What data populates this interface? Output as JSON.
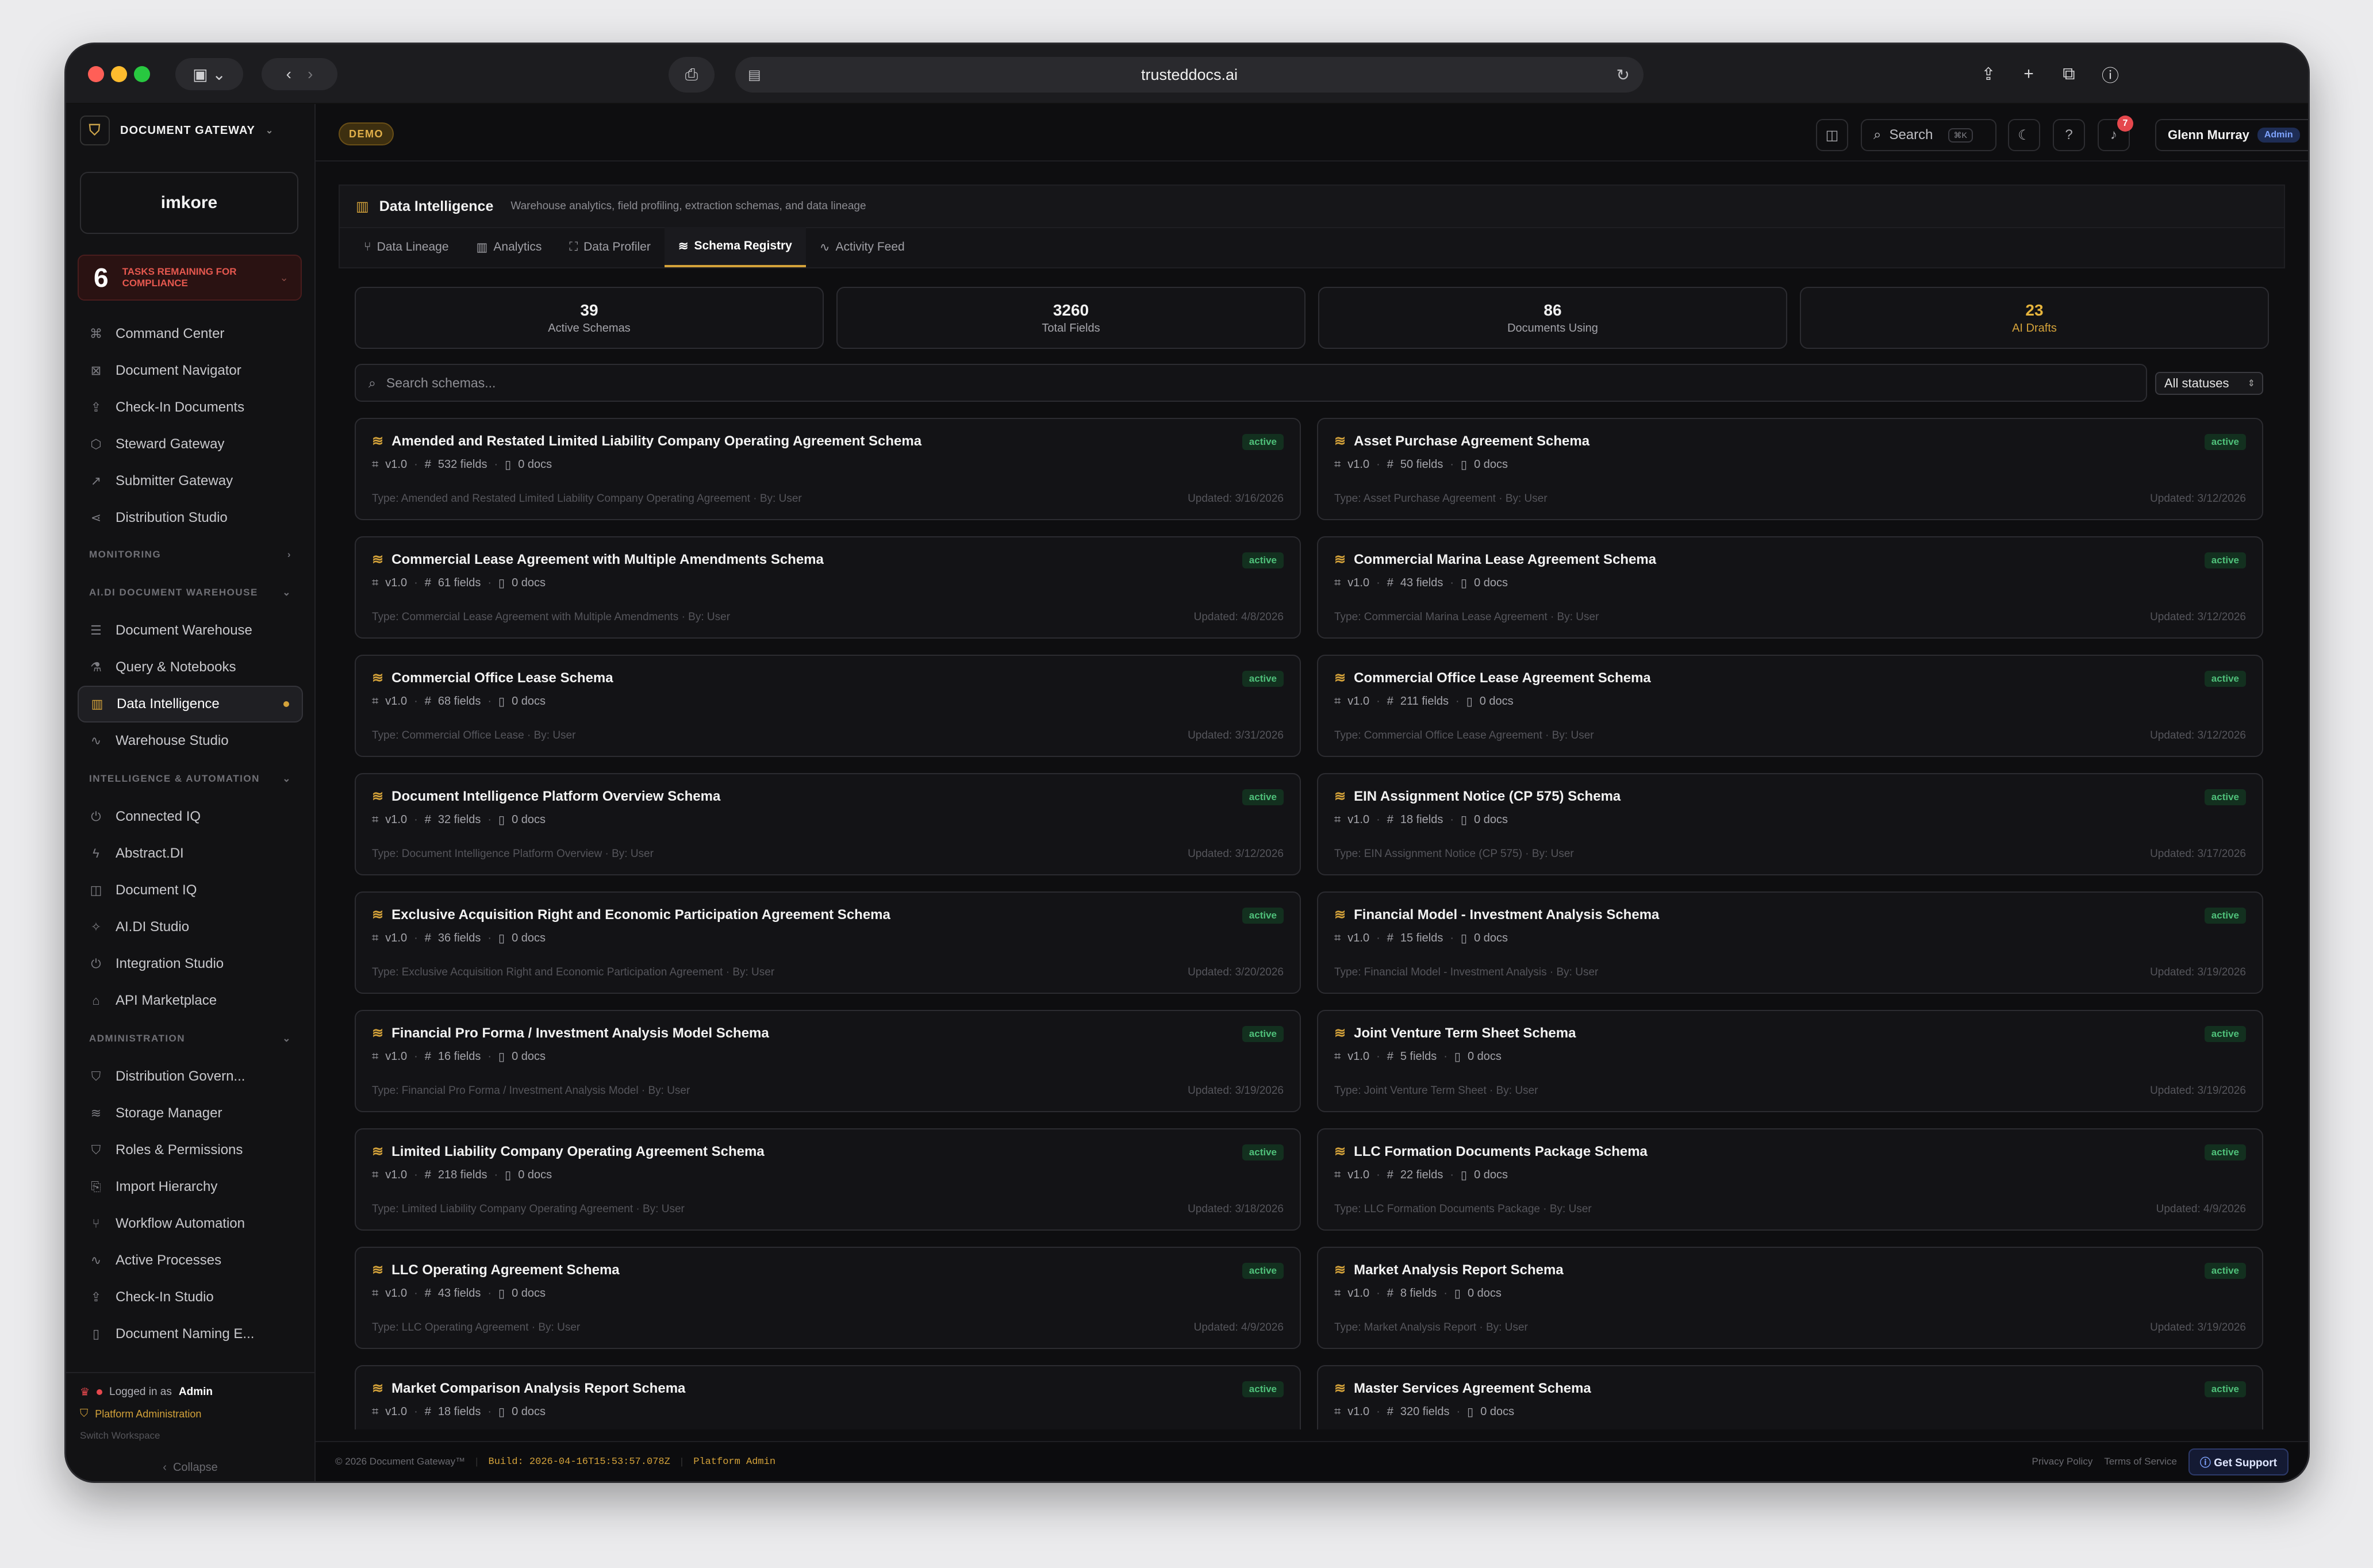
{
  "browser": {
    "url": "trusteddocs.ai"
  },
  "sidebar": {
    "brand": "DOCUMENT GATEWAY",
    "org_logo": "imkore",
    "tasks": {
      "count": "6",
      "label": "TASKS REMAINING FOR COMPLIANCE"
    },
    "top_items": [
      {
        "label": "Command Center",
        "icon": "command-icon"
      },
      {
        "label": "Document Navigator",
        "icon": "navigator-icon"
      },
      {
        "label": "Check-In Documents",
        "icon": "upload-icon"
      },
      {
        "label": "Steward Gateway",
        "icon": "box-icon"
      },
      {
        "label": "Submitter Gateway",
        "icon": "external-link-icon"
      },
      {
        "label": "Distribution Studio",
        "icon": "share-icon"
      }
    ],
    "sections": {
      "monitoring": "MONITORING",
      "warehouse": "AI.DI DOCUMENT WAREHOUSE",
      "intel": "INTELLIGENCE & AUTOMATION",
      "admin": "ADMINISTRATION"
    },
    "warehouse_items": [
      {
        "label": "Document Warehouse"
      },
      {
        "label": "Query & Notebooks"
      },
      {
        "label": "Data Intelligence",
        "active": true
      },
      {
        "label": "Warehouse Studio"
      }
    ],
    "intel_items": [
      {
        "label": "Connected IQ"
      },
      {
        "label": "Abstract.DI"
      },
      {
        "label": "Document IQ"
      },
      {
        "label": "AI.DI Studio"
      },
      {
        "label": "Integration Studio"
      },
      {
        "label": "API Marketplace"
      }
    ],
    "admin_items": [
      {
        "label": "Distribution Govern..."
      },
      {
        "label": "Storage Manager"
      },
      {
        "label": "Roles & Permissions"
      },
      {
        "label": "Import Hierarchy"
      },
      {
        "label": "Workflow Automation"
      },
      {
        "label": "Active Processes"
      },
      {
        "label": "Check-In Studio"
      },
      {
        "label": "Document Naming E..."
      }
    ],
    "footer": {
      "logged_in_prefix": "Logged in as",
      "logged_in_role": "Admin",
      "platform": "Platform Administration",
      "switch": "Switch Workspace",
      "collapse": "Collapse"
    }
  },
  "topbar": {
    "demo": "DEMO",
    "search_label": "Search",
    "search_kbd": "⌘K",
    "notifications": "7",
    "user_name": "Glenn Murray",
    "user_role": "Admin"
  },
  "page": {
    "title": "Data Intelligence",
    "subtitle": "Warehouse analytics, field profiling, extraction schemas, and data lineage",
    "tabs": [
      {
        "label": "Data Lineage",
        "icon": "lineage-icon"
      },
      {
        "label": "Analytics",
        "icon": "bar-chart-icon"
      },
      {
        "label": "Data Profiler",
        "icon": "scan-icon"
      },
      {
        "label": "Schema Registry",
        "icon": "layers-icon",
        "active": true
      },
      {
        "label": "Activity Feed",
        "icon": "activity-icon"
      }
    ]
  },
  "stats": [
    {
      "value": "39",
      "label": "Active Schemas"
    },
    {
      "value": "3260",
      "label": "Total Fields"
    },
    {
      "value": "86",
      "label": "Documents Using"
    },
    {
      "value": "23",
      "label": "AI Drafts",
      "accent": "#e6b43c"
    }
  ],
  "filter": {
    "placeholder": "Search schemas...",
    "status": "All statuses"
  },
  "schemas": [
    {
      "name": "Amended and Restated Limited Liability Company Operating Agreement Schema",
      "status": "active",
      "version": "v1.0",
      "fields": "532 fields",
      "docs": "0 docs",
      "type": "Type: Amended and Restated Limited Liability Company Operating Agreement · By: User",
      "updated": "Updated: 3/16/2026"
    },
    {
      "name": "Asset Purchase Agreement Schema",
      "status": "active",
      "version": "v1.0",
      "fields": "50 fields",
      "docs": "0 docs",
      "type": "Type: Asset Purchase Agreement · By: User",
      "updated": "Updated: 3/12/2026"
    },
    {
      "name": "Commercial Lease Agreement with Multiple Amendments Schema",
      "status": "active",
      "version": "v1.0",
      "fields": "61 fields",
      "docs": "0 docs",
      "type": "Type: Commercial Lease Agreement with Multiple Amendments · By: User",
      "updated": "Updated: 4/8/2026"
    },
    {
      "name": "Commercial Marina Lease Agreement Schema",
      "status": "active",
      "version": "v1.0",
      "fields": "43 fields",
      "docs": "0 docs",
      "type": "Type: Commercial Marina Lease Agreement · By: User",
      "updated": "Updated: 3/12/2026"
    },
    {
      "name": "Commercial Office Lease Schema",
      "status": "active",
      "version": "v1.0",
      "fields": "68 fields",
      "docs": "0 docs",
      "type": "Type: Commercial Office Lease · By: User",
      "updated": "Updated: 3/31/2026"
    },
    {
      "name": "Commercial Office Lease Agreement Schema",
      "status": "active",
      "version": "v1.0",
      "fields": "211 fields",
      "docs": "0 docs",
      "type": "Type: Commercial Office Lease Agreement · By: User",
      "updated": "Updated: 3/12/2026"
    },
    {
      "name": "Document Intelligence Platform Overview Schema",
      "status": "active",
      "version": "v1.0",
      "fields": "32 fields",
      "docs": "0 docs",
      "type": "Type: Document Intelligence Platform Overview · By: User",
      "updated": "Updated: 3/12/2026"
    },
    {
      "name": "EIN Assignment Notice (CP 575) Schema",
      "status": "active",
      "version": "v1.0",
      "fields": "18 fields",
      "docs": "0 docs",
      "type": "Type: EIN Assignment Notice (CP 575) · By: User",
      "updated": "Updated: 3/17/2026"
    },
    {
      "name": "Exclusive Acquisition Right and Economic Participation Agreement Schema",
      "status": "active",
      "version": "v1.0",
      "fields": "36 fields",
      "docs": "0 docs",
      "type": "Type: Exclusive Acquisition Right and Economic Participation Agreement · By: User",
      "updated": "Updated: 3/20/2026"
    },
    {
      "name": "Financial Model - Investment Analysis Schema",
      "status": "active",
      "version": "v1.0",
      "fields": "15 fields",
      "docs": "0 docs",
      "type": "Type: Financial Model - Investment Analysis · By: User",
      "updated": "Updated: 3/19/2026"
    },
    {
      "name": "Financial Pro Forma / Investment Analysis Model Schema",
      "status": "active",
      "version": "v1.0",
      "fields": "16 fields",
      "docs": "0 docs",
      "type": "Type: Financial Pro Forma / Investment Analysis Model · By: User",
      "updated": "Updated: 3/19/2026"
    },
    {
      "name": "Joint Venture Term Sheet Schema",
      "status": "active",
      "version": "v1.0",
      "fields": "5 fields",
      "docs": "0 docs",
      "type": "Type: Joint Venture Term Sheet · By: User",
      "updated": "Updated: 3/19/2026"
    },
    {
      "name": "Limited Liability Company Operating Agreement Schema",
      "status": "active",
      "version": "v1.0",
      "fields": "218 fields",
      "docs": "0 docs",
      "type": "Type: Limited Liability Company Operating Agreement · By: User",
      "updated": "Updated: 3/18/2026"
    },
    {
      "name": "LLC Formation Documents Package Schema",
      "status": "active",
      "version": "v1.0",
      "fields": "22 fields",
      "docs": "0 docs",
      "type": "Type: LLC Formation Documents Package · By: User",
      "updated": "Updated: 4/9/2026"
    },
    {
      "name": "LLC Operating Agreement Schema",
      "status": "active",
      "version": "v1.0",
      "fields": "43 fields",
      "docs": "0 docs",
      "type": "Type: LLC Operating Agreement · By: User",
      "updated": "Updated: 4/9/2026"
    },
    {
      "name": "Market Analysis Report Schema",
      "status": "active",
      "version": "v1.0",
      "fields": "8 fields",
      "docs": "0 docs",
      "type": "Type: Market Analysis Report · By: User",
      "updated": "Updated: 3/19/2026"
    },
    {
      "name": "Market Comparison Analysis Report Schema",
      "status": "active",
      "version": "v1.0",
      "fields": "18 fields",
      "docs": "0 docs",
      "type": "",
      "updated": ""
    },
    {
      "name": "Master Services Agreement Schema",
      "status": "active",
      "version": "v1.0",
      "fields": "320 fields",
      "docs": "0 docs",
      "type": "",
      "updated": ""
    }
  ],
  "footer": {
    "copyright": "© 2026 Document Gateway™",
    "build": "Build: 2026-04-16T15:53:57.078Z",
    "platform": "Platform Admin",
    "privacy": "Privacy Policy",
    "terms": "Terms of Service",
    "support": "Get Support"
  }
}
